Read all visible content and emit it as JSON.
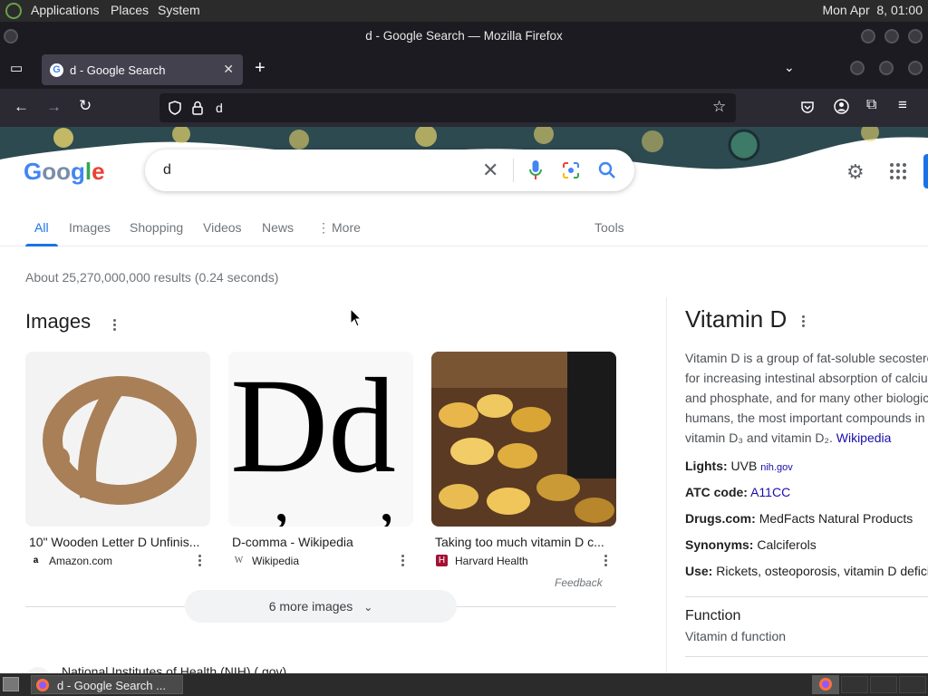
{
  "system_panel": {
    "menus": [
      "Applications",
      "Places",
      "System"
    ],
    "clock": "Mon Apr  8, 01:00"
  },
  "window": {
    "title": "d - Google Search — Mozilla Firefox"
  },
  "browser": {
    "tab_title": "d - Google Search",
    "url": "d"
  },
  "google": {
    "logo": "Google",
    "query": "d",
    "nav_tabs": [
      "All",
      "Images",
      "Shopping",
      "Videos",
      "News",
      "More"
    ],
    "tools_label": "Tools",
    "result_stats": "About 25,270,000,000 results (0.24 seconds)",
    "images_heading": "Images",
    "images": [
      {
        "caption": "10\" Wooden Letter D Unfinis...",
        "source": "Amazon.com"
      },
      {
        "caption": "D-comma - Wikipedia",
        "source": "Wikipedia"
      },
      {
        "caption": "Taking too much vitamin D c...",
        "source": "Harvard Health"
      }
    ],
    "feedback": "Feedback",
    "more_images": "6 more images",
    "next_result": "National Institutes of Health (NIH) (.gov)"
  },
  "knowledge_panel": {
    "title": "Vitamin D",
    "description_lines": [
      "Vitamin D is a group of fat-soluble secostero",
      "for increasing intestinal absorption of calciu",
      "and phosphate, and for many other biologic",
      "humans, the most important compounds in"
    ],
    "desc_last": "vitamin D₃ and vitamin D₂.",
    "desc_link": "Wikipedia",
    "lights_label": "Lights:",
    "lights_value": "UVB",
    "lights_source": "nih.gov",
    "atc_label": "ATC code:",
    "atc_value": "A11CC",
    "drugs_label": "Drugs.com:",
    "drugs_value": "MedFacts Natural Products",
    "synonyms_label": "Synonyms:",
    "synonyms_value": "Calciferols",
    "use_label": "Use:",
    "use_value": "Rickets, osteoporosis, vitamin D defici",
    "function_heading": "Function",
    "function_sub": "Vitamin d function"
  },
  "taskbar": {
    "task_label": "d - Google Search ..."
  }
}
